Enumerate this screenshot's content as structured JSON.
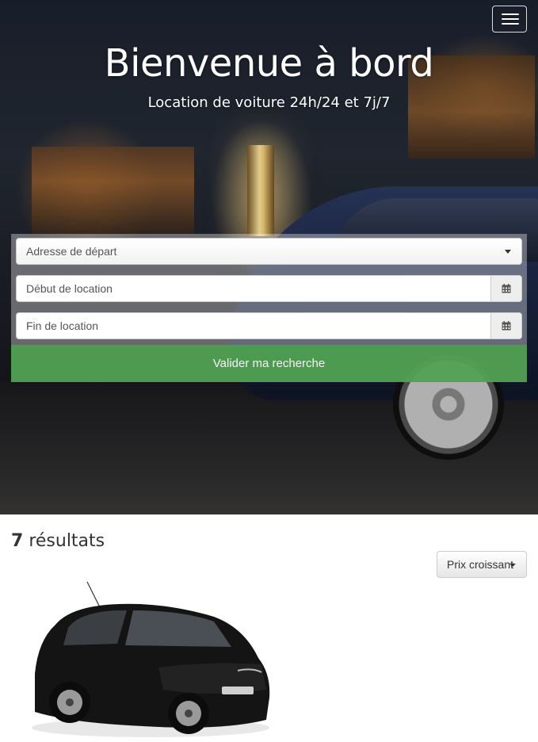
{
  "hero": {
    "title": "Bienvenue à bord",
    "subtitle": "Location de voiture 24h/24 et 7j/7"
  },
  "nav": {
    "menu_icon": "hamburger-icon"
  },
  "search": {
    "address_placeholder": "Adresse de départ",
    "start_placeholder": "Début de location",
    "end_placeholder": "Fin de location",
    "calendar_icon": "calendar-icon",
    "submit_label": "Valider ma recherche",
    "submit_color": "#4c9e4f"
  },
  "results": {
    "count": "7",
    "label": "résultats",
    "sort_label": "Prix croissant"
  }
}
